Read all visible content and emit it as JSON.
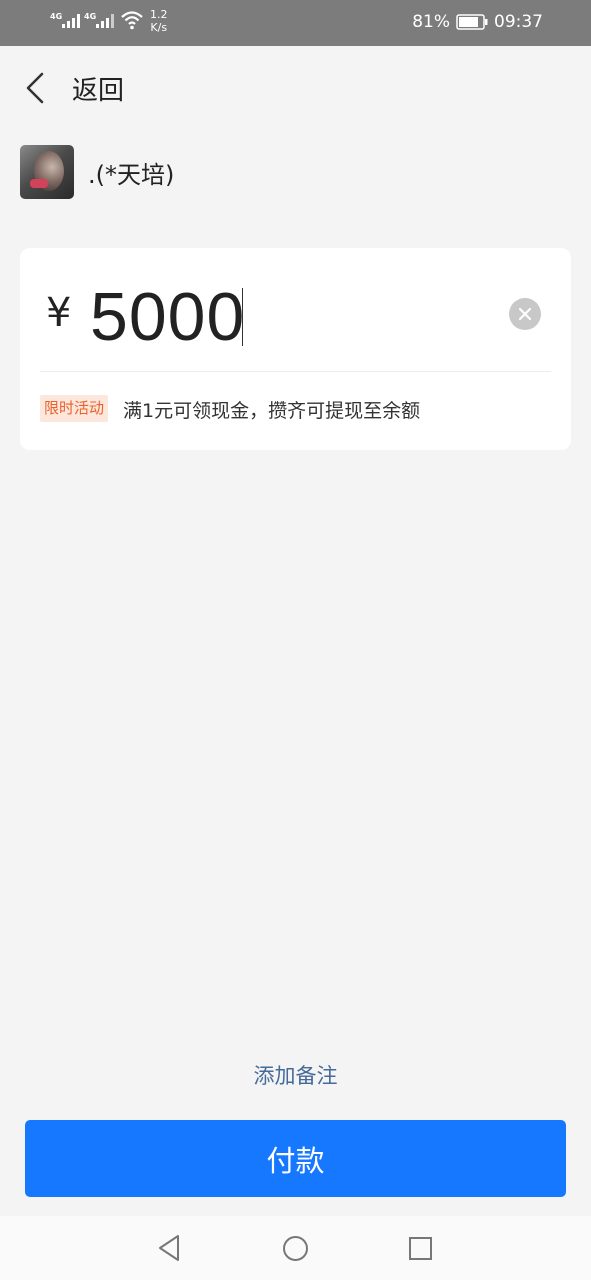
{
  "status_bar": {
    "network_1": "4G",
    "network_2": "4G",
    "speed_value": "1.2",
    "speed_unit": "K/s",
    "battery": "81%",
    "time": "09:37"
  },
  "header": {
    "back_label": "返回"
  },
  "payee": {
    "name": ".(*天培)"
  },
  "amount": {
    "currency": "¥",
    "value": "5000"
  },
  "promo": {
    "tag": "限时活动",
    "text": "满1元可领现金，攒齐可提现至余额"
  },
  "actions": {
    "add_note": "添加备注",
    "pay": "付款"
  },
  "colors": {
    "primary": "#1677ff",
    "promo_tag_bg": "#fde6dc",
    "promo_tag_text": "#e8632b",
    "link": "#466a99"
  }
}
